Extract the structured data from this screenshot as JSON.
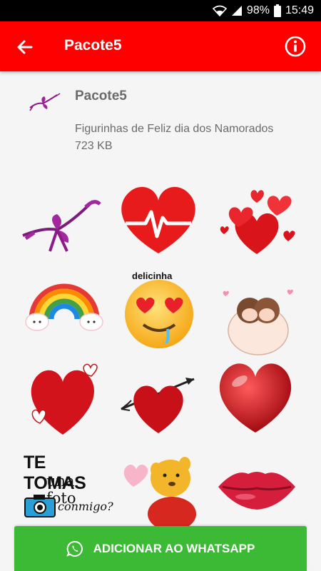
{
  "status_bar": {
    "battery": "98%",
    "time": "15:49",
    "icons": [
      "wifi-icon",
      "signal-icon",
      "battery-icon"
    ]
  },
  "app_bar": {
    "title": "Pacote5",
    "back_icon": "arrow-left-icon",
    "info_icon": "info-circle-icon",
    "color": "#ff0000"
  },
  "pack": {
    "name": "Pacote5",
    "description": "Figurinhas de Feliz dia dos Namorados",
    "size": "723 KB"
  },
  "stickers": [
    {
      "name": "ribbon-bow"
    },
    {
      "name": "heartbeat-heart"
    },
    {
      "name": "hearts-cluster"
    },
    {
      "name": "rainbow-clouds"
    },
    {
      "name": "heart-eyes-emoji",
      "caption": "delicinha"
    },
    {
      "name": "couple-blanket"
    },
    {
      "name": "hearts-red-cutout"
    },
    {
      "name": "heart-arrow"
    },
    {
      "name": "glossy-heart"
    },
    {
      "name": "te-tomas-foto",
      "line1": "TE TOMAS",
      "line2": "una foto",
      "line3": "conmigo?"
    },
    {
      "name": "pooh-heart"
    },
    {
      "name": "red-lips"
    }
  ],
  "add_button": {
    "label": "ADICIONAR AO WHATSAPP",
    "icon": "whatsapp-icon",
    "color": "#3cba35"
  }
}
